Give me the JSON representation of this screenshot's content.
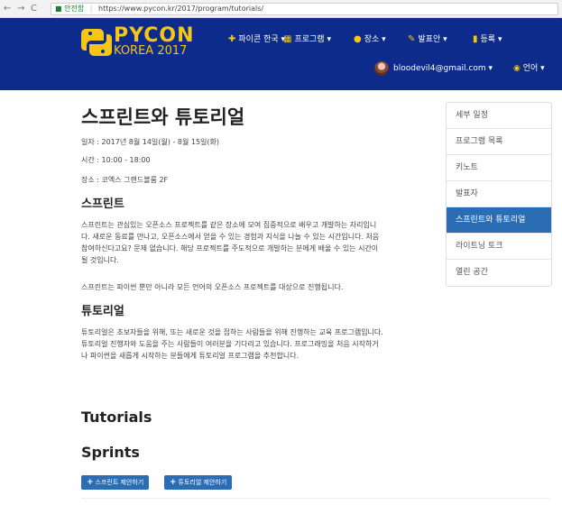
{
  "browser": {
    "secure_label": "안전함",
    "url": "https://www.pycon.kr/2017/program/tutorials/"
  },
  "header": {
    "logo_line1": "PYCON",
    "logo_line2": "KOREA 2017",
    "menu": [
      {
        "label": "파이콘 한국",
        "icon": "plus-icon"
      },
      {
        "label": "프로그램",
        "icon": "calendar-icon"
      },
      {
        "label": "장소",
        "icon": "map-marker-icon"
      },
      {
        "label": "발표안",
        "icon": "edit-icon"
      },
      {
        "label": "등록",
        "icon": "ticket-icon"
      }
    ],
    "user_email": "bloodevil4@gmail.com",
    "language": "언어"
  },
  "main": {
    "title": "스프린트와 튜토리얼",
    "date": "일자 : 2017년 8월 14일(월) - 8월 15일(화)",
    "time": "시간 : 10:00 - 18:00",
    "place": "장소 : 코엑스 그랜드볼룸 2F",
    "sprint_heading": "스프린트",
    "sprint_p1_l1": "스프린트는 관심있는 오픈소스 프로젝트를 같은 장소에 모여 집중적으로 배우고 개발하는 자리입니",
    "sprint_p1_l2": "다. 새로운 동료를 만나고, 오픈소스에서 얻을 수 있는 경험과 지식을 나눌 수 있는 시간입니다. 처음",
    "sprint_p1_l3": "참여하신다고요? 문제 없습니다. 해당 프로젝트를 주도적으로 개발하는 분에게 배울 수 있는 시간이",
    "sprint_p1_l4": "될 것입니다.",
    "sprint_p2": "스프린트는 파이썬 뿐만 아니라 모든 언어의 오픈소스 프로젝트를 대상으로 진행됩니다.",
    "tutorial_heading": "튜토리얼",
    "tutorial_p_l1": "튜토리얼은 초보자들을 위해, 또는 새로운 것을 접하는 사람들을 위해 진행하는 교육 프로그램입니다.",
    "tutorial_p_l2": "튜토리얼 진행자와 도움을 주는 사람들이 여러분을 기다리고 있습니다. 프로그래밍을 처음 시작하거",
    "tutorial_p_l3": "나 파이썬을 새롭게 시작하는 분들에게 튜토리얼 프로그램을 추천합니다.",
    "tutorials_title": "Tutorials",
    "sprints_title": "Sprints",
    "propose_sprint": "스프린트 제안하기",
    "propose_tutorial": "튜토리얼 제안하기"
  },
  "sidebar": {
    "items": [
      {
        "label": "세부 일정",
        "active": false
      },
      {
        "label": "프로그램 목록",
        "active": false
      },
      {
        "label": "키노트",
        "active": false
      },
      {
        "label": "발표자",
        "active": false
      },
      {
        "label": "스프린트와 튜토리얼",
        "active": true
      },
      {
        "label": "라이트닝 토크",
        "active": false
      },
      {
        "label": "열린 공간",
        "active": false
      }
    ]
  },
  "colors": {
    "header_bg": "#0c2b8a",
    "brand_yellow": "#f5c518",
    "accent_blue": "#2a6db5"
  }
}
